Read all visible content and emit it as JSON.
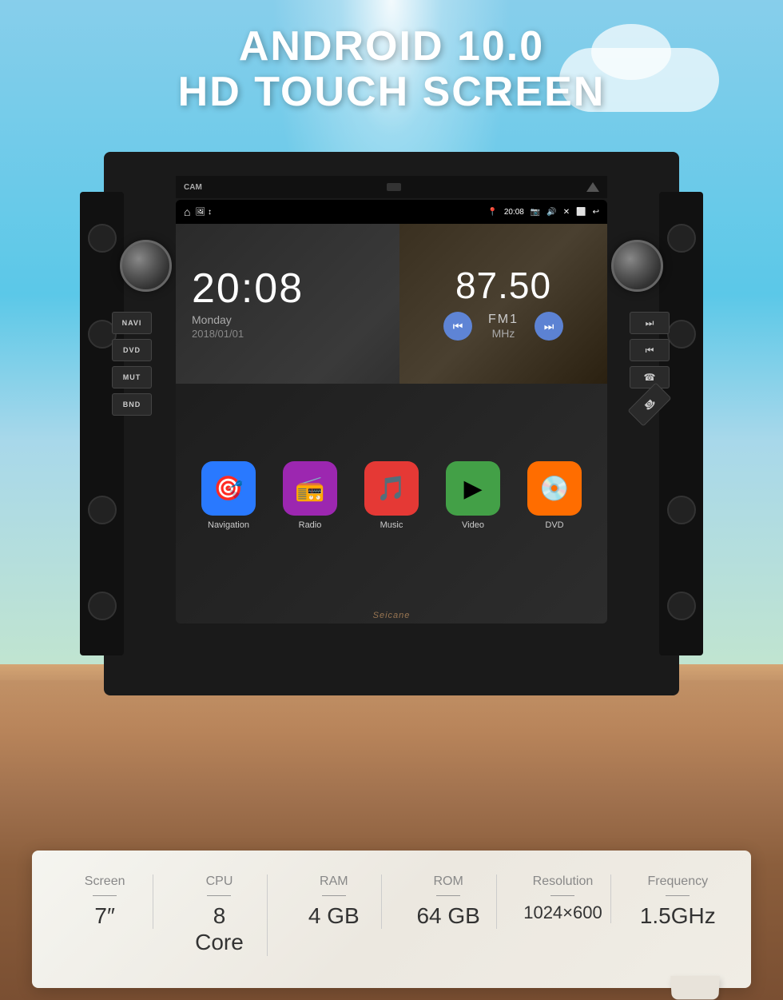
{
  "header": {
    "line1": "ANDROID 10.0",
    "line2": "HD TOUCH SCREEN"
  },
  "screen": {
    "time": "20:08",
    "day": "Monday",
    "date": "2018/01/01",
    "radio_freq": "87.50",
    "radio_band": "FM1",
    "radio_unit": "MHz",
    "watermark": "Seicane"
  },
  "status_bar": {
    "location_icon": "📍",
    "time": "20:08",
    "camera_icon": "📷",
    "volume_icon": "🔊"
  },
  "side_buttons": {
    "left": [
      "NAVI",
      "DVD",
      "MUT",
      "BND"
    ],
    "right_media": [
      "⏭",
      "⏮",
      "☎",
      "📞"
    ]
  },
  "apps": [
    {
      "label": "Navigation",
      "color": "#2979ff",
      "icon": "🎯"
    },
    {
      "label": "Radio",
      "color": "#9c27b0",
      "icon": "📻"
    },
    {
      "label": "Music",
      "color": "#e53935",
      "icon": "🎵"
    },
    {
      "label": "Video",
      "color": "#43a047",
      "icon": "▶"
    },
    {
      "label": "DVD",
      "color": "#ff6d00",
      "icon": "💿"
    }
  ],
  "specs": [
    {
      "label": "Screen",
      "value": "7\""
    },
    {
      "label": "CPU",
      "value": "8\nCore"
    },
    {
      "label": "RAM",
      "value": "4 GB"
    },
    {
      "label": "ROM",
      "value": "64 GB"
    },
    {
      "label": "Resolution",
      "value": "1024×600"
    },
    {
      "label": "Frequency",
      "value": "1.5GHz"
    }
  ],
  "colors": {
    "accent_blue": "#2979ff",
    "accent_purple": "#9c27b0",
    "accent_red": "#e53935",
    "accent_green": "#43a047",
    "accent_orange": "#ff6d00"
  }
}
